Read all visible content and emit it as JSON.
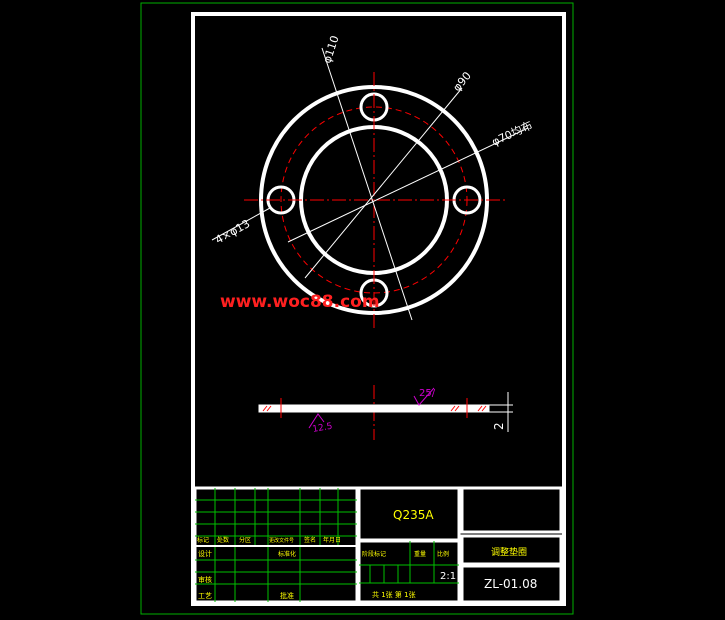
{
  "drawing": {
    "dimensions": {
      "bore": "φ110",
      "outer": "φ90",
      "bolt_circle": "φ70均布",
      "holes": "4×φ13",
      "thickness": "2"
    },
    "surface_finish": {
      "top": "25/",
      "bottom": "12.5"
    },
    "watermark": "www.woc88.com"
  },
  "title_block": {
    "material": "Q235A",
    "part_name": "调整垫圈",
    "scale_value": "2:1",
    "drawing_number": "ZL-01.08",
    "rev_headers": [
      "标记",
      "处数",
      "分区",
      "更改文件号",
      "签名",
      "年月日"
    ],
    "sign_labels": [
      "设计",
      "审核",
      "工艺"
    ],
    "sign_mid_labels": [
      "标准化",
      "批准"
    ],
    "stage_labels": [
      "阶段标记",
      "重量",
      "比例"
    ],
    "sheet_info": "共 1张 第 1张"
  },
  "colors": {
    "frame": "#ffffff",
    "outer_border": "#00b000",
    "center_line": "#ff0000",
    "dimension": "#ffffff",
    "hatch": "#ff0000",
    "finish": "#d000d0",
    "title_grid": "#00c000",
    "title_text": "#ffff00",
    "watermark": "#ff2020"
  }
}
